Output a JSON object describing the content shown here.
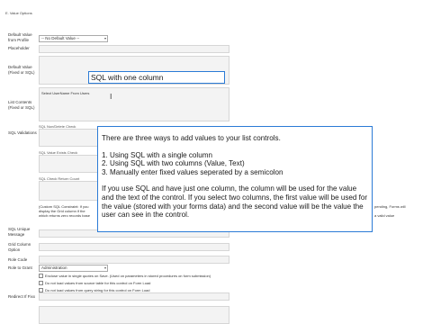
{
  "section": {
    "title": "E. Value Options"
  },
  "labels": {
    "default_value": "Default Value from Profile",
    "placeholder": "Placeholder",
    "default_fixed": "Default Value (Fixed or SQL)",
    "list_contents": "List Contents (Fixed or SQL)",
    "sql_validations": "SQL Validations",
    "sql_unique": "SQL Unique Message",
    "grid_column": "Grid Column Option",
    "role_code": "Role Code",
    "role_to_grant": "Role to Grant",
    "redirect": "Redirect If Fixx"
  },
  "default_value_select": "-- No Default Value --",
  "list_contents_value": "Select UserName From Users",
  "sublabels": {
    "pre_check": "SQL Non/Delete Check",
    "value_exists": "SQL Value Exists Check",
    "check_return": "SQL Check Return Count"
  },
  "custom_sql_note": "(Custom SQL Constraint: If you",
  "custom_sql_note2": "display the Grid column if the",
  "custom_sql_note3": "which returns zero records base",
  "right_note": "pending, Forms will",
  "right_note2": "a valid value",
  "role_select": "Administration",
  "checkboxes": [
    "Enclose value in single quotes on Save. (Used on parameters in stored procedures on form submission)",
    "Do not load values from source table for this control on Form Load",
    "Do not load values from query string for this control on Form Load"
  ],
  "callout_small": "SQL with one column",
  "callout_large": {
    "intro": "There are three ways to add values to your list controls.",
    "items": [
      "1. Using SQL with a single column",
      "2. Using SQL with two columns (Value, Text)",
      "3. Manually enter fixed values seperated by a semicolon"
    ],
    "body": "If you use SQL and have just one column, the column will be used for the value and the text of the control.  If you select two columns, the first value will be used for the value (stored with your forms data) and the second value will be the value the user can see in the control."
  },
  "icons": [
    "text-cursor-icon",
    "chevron-down-icon"
  ]
}
